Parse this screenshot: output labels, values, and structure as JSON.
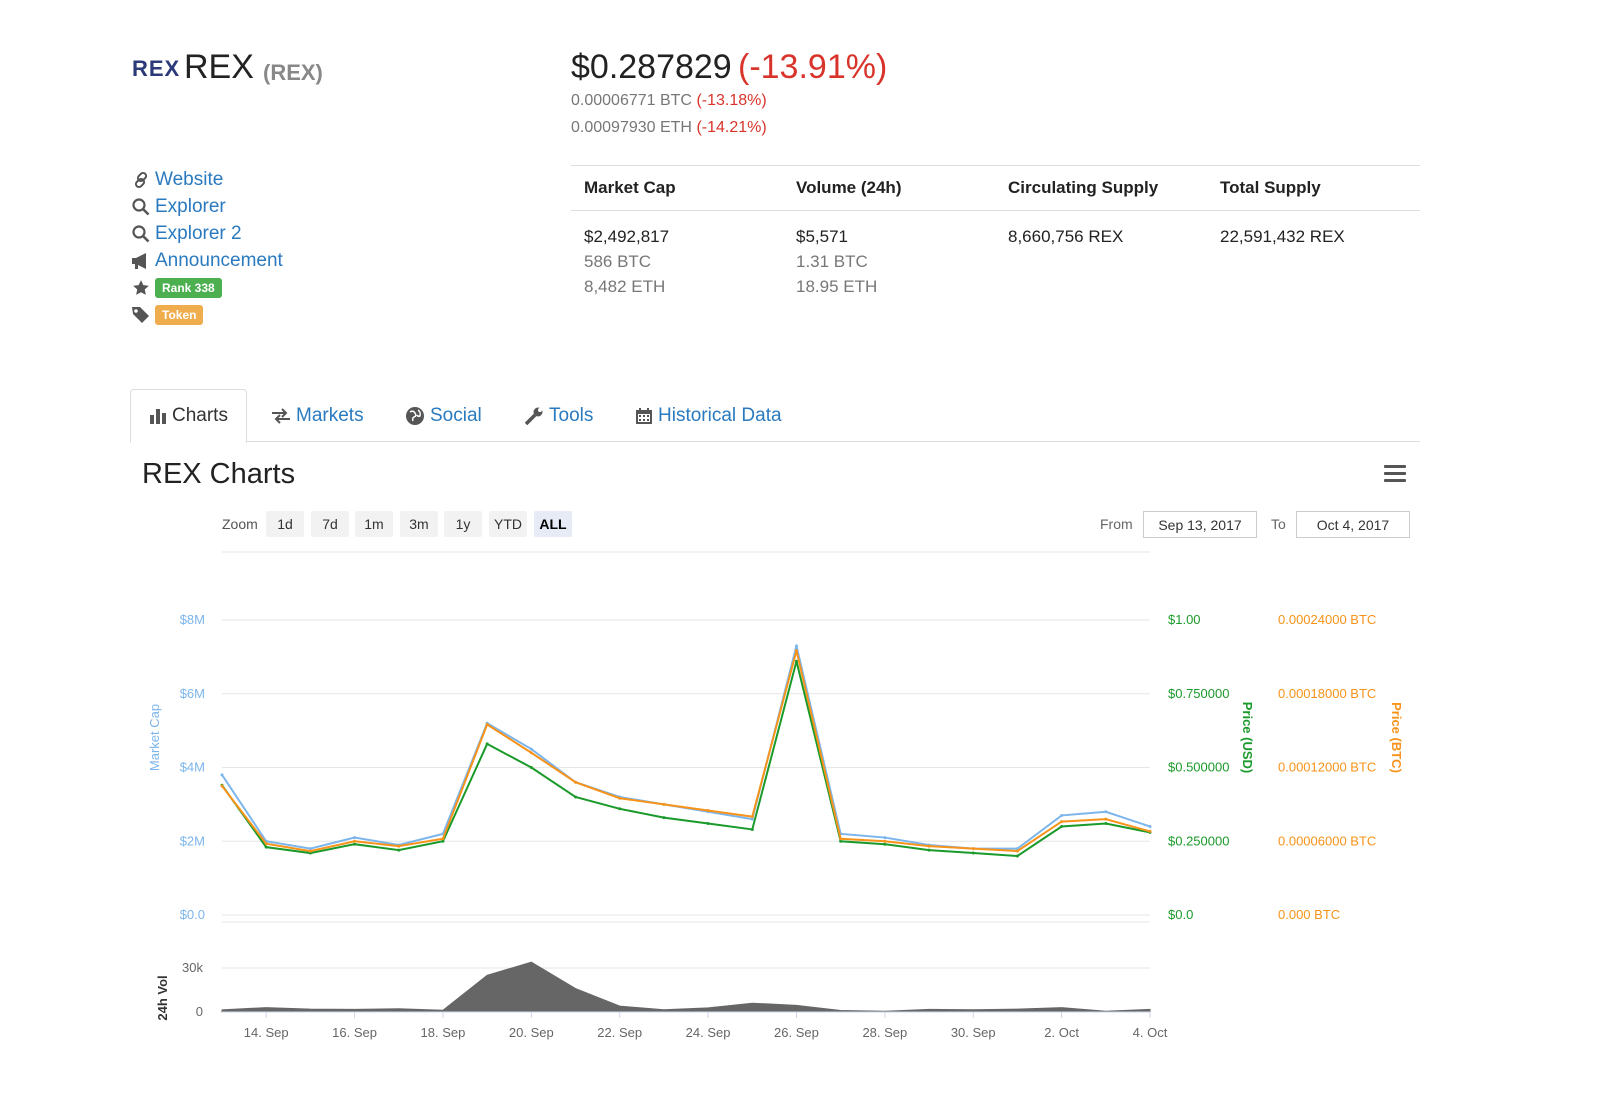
{
  "coin": {
    "logo_text": "REX",
    "name": "REX",
    "symbol": "(REX)"
  },
  "price": {
    "usd": "$0.287829",
    "usd_change": "(-13.91%)",
    "btc": "0.00006771 BTC",
    "btc_change": "(-13.18%)",
    "eth": "0.00097930 ETH",
    "eth_change": "(-14.21%)"
  },
  "links": [
    {
      "label": "Website",
      "icon": "link-icon"
    },
    {
      "label": "Explorer",
      "icon": "search-icon"
    },
    {
      "label": "Explorer 2",
      "icon": "search-icon"
    },
    {
      "label": "Announcement",
      "icon": "bullhorn-icon"
    }
  ],
  "badges": {
    "rank": "Rank 338",
    "rank_color": "#4caf50",
    "type": "Token",
    "type_color": "#f0ad4e"
  },
  "stats": {
    "headers": [
      "Market Cap",
      "Volume (24h)",
      "Circulating Supply",
      "Total Supply"
    ],
    "market_cap": [
      "$2,492,817",
      "586 BTC",
      "8,482 ETH"
    ],
    "volume": [
      "$5,571",
      "1.31 BTC",
      "18.95 ETH"
    ],
    "circulating": "8,660,756 REX",
    "total": "22,591,432 REX"
  },
  "tabs": [
    {
      "label": "Charts",
      "icon": "bar-chart-icon",
      "active": true
    },
    {
      "label": "Markets",
      "icon": "exchange-icon",
      "active": false
    },
    {
      "label": "Social",
      "icon": "globe-icon",
      "active": false
    },
    {
      "label": "Tools",
      "icon": "wrench-icon",
      "active": false
    },
    {
      "label": "Historical Data",
      "icon": "calendar-icon",
      "active": false
    }
  ],
  "chart_section": {
    "title": "REX Charts",
    "zoom_label": "Zoom",
    "zoom_buttons": [
      "1d",
      "7d",
      "1m",
      "3m",
      "1y",
      "YTD",
      "ALL"
    ],
    "zoom_selected": "ALL",
    "from_label": "From",
    "from_value": "Sep 13, 2017",
    "to_label": "To",
    "to_value": "Oct 4, 2017"
  },
  "colors": {
    "market_cap": "#7cb5ec",
    "price_usd": "#1a9a2a",
    "price_btc": "#f7931a",
    "volume": "#666666",
    "link": "#2a7abf",
    "negative": "#d9342b"
  },
  "chart_data": {
    "type": "line",
    "x_tick_labels": [
      "14. Sep",
      "16. Sep",
      "18. Sep",
      "20. Sep",
      "22. Sep",
      "24. Sep",
      "26. Sep",
      "28. Sep",
      "30. Sep",
      "2. Oct",
      "4. Oct"
    ],
    "left_axis": {
      "label": "Market Cap",
      "ticks": [
        "$0.0",
        "$2M",
        "$4M",
        "$6M",
        "$8M"
      ],
      "range": [
        0,
        8000000
      ]
    },
    "right_axis_usd": {
      "label": "Price (USD)",
      "ticks": [
        "$0.0",
        "$0.250000",
        "$0.500000",
        "$0.750000",
        "$1.00"
      ],
      "range": [
        0,
        1.0
      ]
    },
    "right_axis_btc": {
      "label": "Price (BTC)",
      "ticks": [
        "0.000 BTC",
        "0.00006000 BTC",
        "0.00012000 BTC",
        "0.00018000 BTC",
        "0.00024000 BTC"
      ],
      "range": [
        0,
        0.00024
      ]
    },
    "volume_axis": {
      "label": "24h Vol",
      "ticks": [
        "0",
        "30k"
      ],
      "range": [
        0,
        30000
      ]
    },
    "x_range_days": [
      "Sep 13, 2017",
      "Oct 4, 2017"
    ],
    "x_dates": [
      "Sep 13",
      "Sep 14",
      "Sep 15",
      "Sep 16",
      "Sep 17",
      "Sep 18",
      "Sep 19",
      "Sep 20",
      "Sep 21",
      "Sep 22",
      "Sep 23",
      "Sep 24",
      "Sep 25",
      "Sep 26",
      "Sep 27",
      "Sep 28",
      "Sep 29",
      "Sep 30",
      "Oct 1",
      "Oct 2",
      "Oct 3",
      "Oct 4"
    ],
    "series": [
      {
        "name": "Market Cap",
        "values": [
          3800000,
          2000000,
          1800000,
          2100000,
          1900000,
          2200000,
          5200000,
          4500000,
          3600000,
          3200000,
          3000000,
          2800000,
          2600000,
          7300000,
          2200000,
          2100000,
          1900000,
          1800000,
          1800000,
          2700000,
          2800000,
          2400000
        ]
      },
      {
        "name": "Price (USD)",
        "values": [
          0.44,
          0.23,
          0.21,
          0.24,
          0.22,
          0.25,
          0.58,
          0.5,
          0.4,
          0.36,
          0.33,
          0.31,
          0.29,
          0.86,
          0.25,
          0.24,
          0.22,
          0.21,
          0.2,
          0.3,
          0.31,
          0.28
        ]
      },
      {
        "name": "Price (BTC)",
        "values": [
          0.000105,
          5.8e-05,
          5.2e-05,
          6e-05,
          5.6e-05,
          6.2e-05,
          0.000155,
          0.000132,
          0.000108,
          9.5e-05,
          9e-05,
          8.5e-05,
          8e-05,
          0.000215,
          6.2e-05,
          6e-05,
          5.6e-05,
          5.4e-05,
          5.2e-05,
          7.6e-05,
          7.8e-05,
          6.8e-05
        ]
      },
      {
        "name": "24h Vol",
        "values": [
          1500,
          3000,
          2000,
          1800,
          2200,
          1200,
          25000,
          34000,
          16000,
          4000,
          1500,
          2800,
          6000,
          4500,
          1000,
          500,
          1800,
          1500,
          2000,
          3000,
          500,
          1800
        ]
      }
    ]
  }
}
